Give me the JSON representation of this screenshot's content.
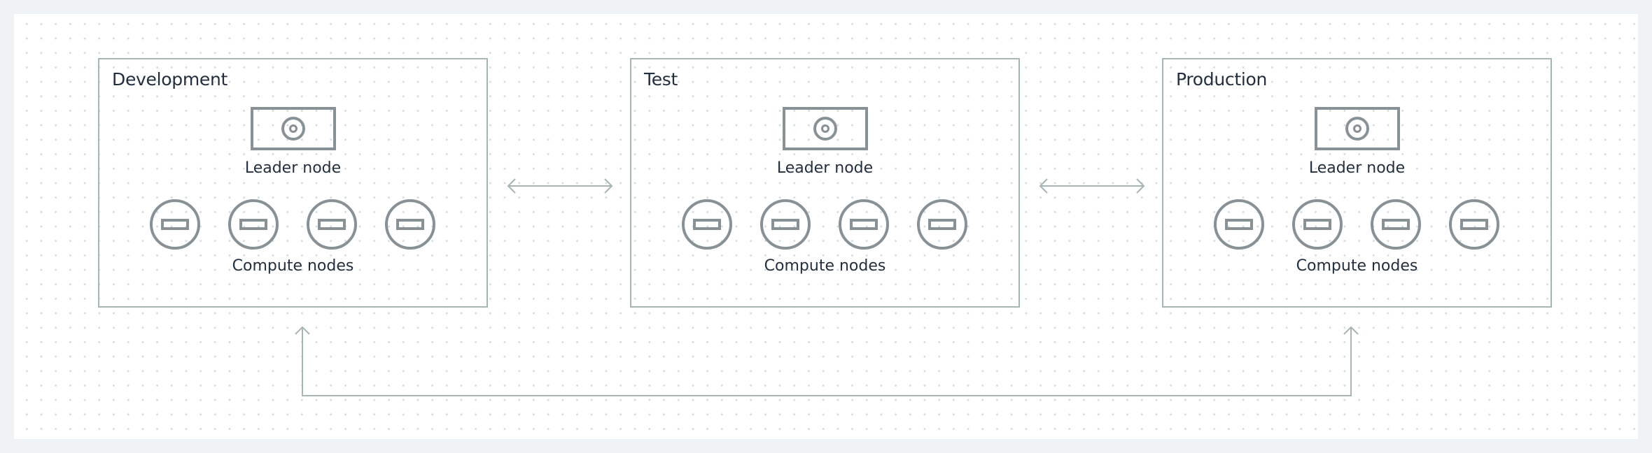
{
  "diagram": {
    "environments": [
      {
        "id": "development",
        "title": "Development",
        "leader_label": "Leader node",
        "compute_label": "Compute nodes",
        "compute_count": 4
      },
      {
        "id": "test",
        "title": "Test",
        "leader_label": "Leader node",
        "compute_label": "Compute nodes",
        "compute_count": 4
      },
      {
        "id": "production",
        "title": "Production",
        "leader_label": "Leader node",
        "compute_label": "Compute nodes",
        "compute_count": 4
      }
    ],
    "connections": [
      {
        "from": "development",
        "to": "test",
        "type": "bidirectional"
      },
      {
        "from": "test",
        "to": "production",
        "type": "bidirectional"
      },
      {
        "from": "development",
        "to": "production",
        "type": "bidirectional-routed-below"
      }
    ],
    "colors": {
      "box_border": "#a7b5b5",
      "icon_stroke": "#879196",
      "text": "#232f3e",
      "background": "#eff3f5",
      "canvas": "#ffffff"
    },
    "icons": {
      "leader": "leader-node-icon",
      "compute": "compute-node-icon"
    }
  }
}
